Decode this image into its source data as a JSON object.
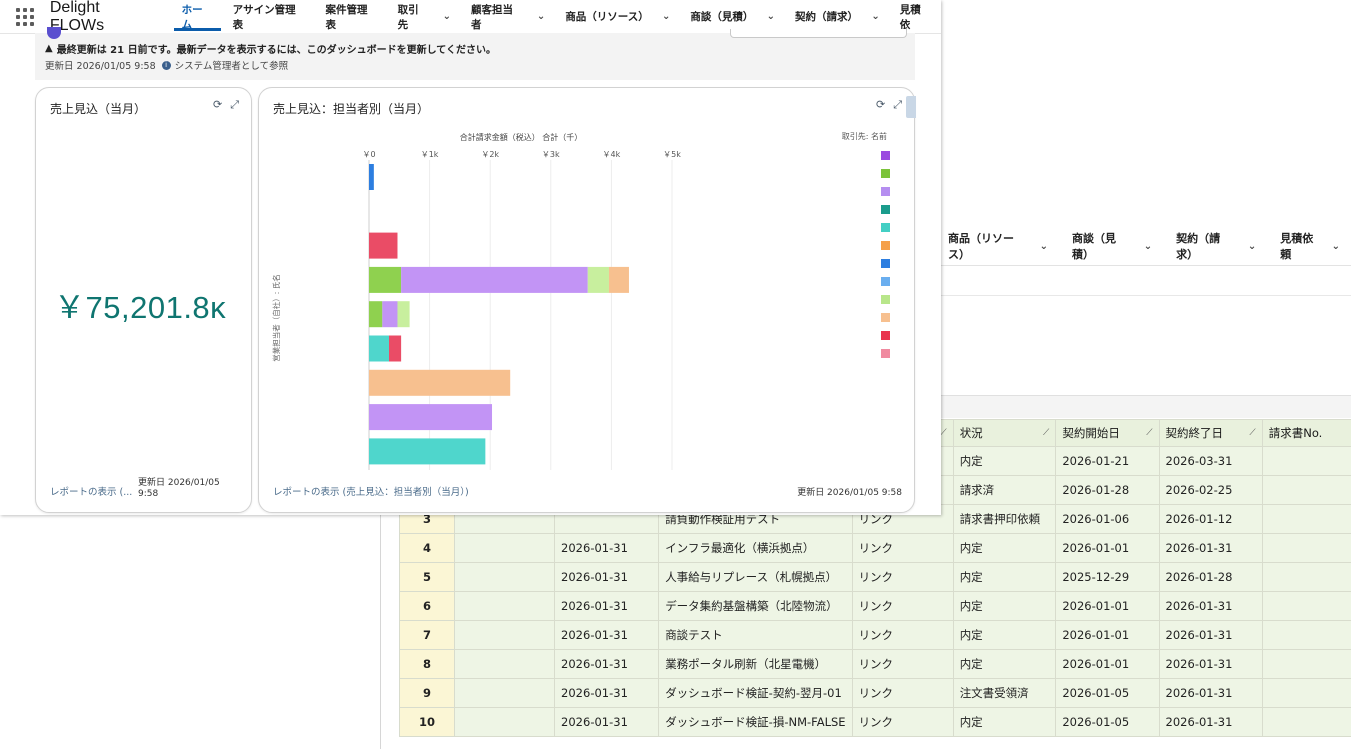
{
  "app": {
    "name": "Delight FLOWs",
    "nav": [
      {
        "label": "ホーム",
        "active": true,
        "chevron": false
      },
      {
        "label": "アサイン管理表",
        "active": false,
        "chevron": false
      },
      {
        "label": "案件管理表",
        "active": false,
        "chevron": false
      },
      {
        "label": "取引先",
        "active": false,
        "chevron": true
      },
      {
        "label": "顧客担当者",
        "active": false,
        "chevron": true
      },
      {
        "label": "商品（リソース）",
        "active": false,
        "chevron": true
      },
      {
        "label": "商談（見積）",
        "active": false,
        "chevron": true
      },
      {
        "label": "契約（請求）",
        "active": false,
        "chevron": true
      },
      {
        "label": "見積依",
        "active": false,
        "chevron": false
      }
    ]
  },
  "dashboard": {
    "warning": "最終更新は 21 日前です。最新データを表示するには、このダッシュボードを更新してください。",
    "updated_at": "更新日 2026/01/05 9:58",
    "viewing_as": "システム管理者として参照",
    "left_card": {
      "title": "売上見込（当月）",
      "metric": "￥75,201.8ĸ",
      "footer_link": "レポートの表示 (...",
      "footer_date": "更新日 2026/01/05 9:58"
    },
    "right_card": {
      "title": "売上見込：担当者別（当月）",
      "footer_link": "レポートの表示 (売上見込：担当者別（当月）)",
      "footer_date": "更新日 2026/01/05 9:58"
    }
  },
  "chart_data": {
    "type": "bar",
    "orientation": "horizontal",
    "stacked": true,
    "title": "合計請求金額（税込） 合計（千）",
    "xlabel": "",
    "ylabel": "営業担当者（自社）: 氏名",
    "xlim": [
      0,
      5000
    ],
    "x_ticks": [
      "￥0",
      "￥1k",
      "￥2k",
      "￥3k",
      "￥4k",
      "￥5k"
    ],
    "legend_title": "取引先: 名前",
    "legend_colors": [
      "#9b4be0",
      "#7cc33a",
      "#b58ef0",
      "#1a9c8c",
      "#43cfc4",
      "#f5a04a",
      "#2d7ee0",
      "#6aaeef",
      "#b8e68a",
      "#f7c08f",
      "#e9344f",
      "#f08aa0"
    ],
    "rows": [
      {
        "segments": [
          {
            "value": 80,
            "color": "#2d7ee0"
          }
        ]
      },
      {
        "segments": []
      },
      {
        "segments": [
          {
            "value": 470,
            "color": "#ea4c66"
          }
        ]
      },
      {
        "segments": [
          {
            "value": 530,
            "color": "#8fd14f"
          },
          {
            "value": 3080,
            "color": "#c294f5"
          },
          {
            "value": 350,
            "color": "#c8ef9e"
          },
          {
            "value": 330,
            "color": "#f7c08f"
          }
        ]
      },
      {
        "segments": [
          {
            "value": 220,
            "color": "#8fd14f"
          },
          {
            "value": 250,
            "color": "#c294f5"
          },
          {
            "value": 200,
            "color": "#c8ef9e"
          }
        ]
      },
      {
        "segments": [
          {
            "value": 330,
            "color": "#4fd6cc"
          },
          {
            "value": 200,
            "color": "#ea4c66"
          }
        ]
      },
      {
        "segments": [
          {
            "value": 2330,
            "color": "#f7c08f"
          }
        ]
      },
      {
        "segments": [
          {
            "value": 2030,
            "color": "#c294f5"
          }
        ]
      },
      {
        "segments": [
          {
            "value": 1920,
            "color": "#4fd6cc"
          }
        ]
      }
    ]
  },
  "back_window": {
    "nav": [
      {
        "label": "商品（リソース）"
      },
      {
        "label": "商談（見積）"
      },
      {
        "label": "契約（請求）"
      },
      {
        "label": "見積依頼"
      }
    ],
    "table": {
      "columns": [
        "",
        "",
        "",
        "",
        "",
        "状況",
        "契約開始日",
        "契約終了日",
        "請求書No."
      ],
      "rows": [
        {
          "no": "",
          "c2": "",
          "date": "",
          "name": "",
          "link": "",
          "status": "内定",
          "start": "2026-01-21",
          "end": "2026-03-31",
          "invoice": ""
        },
        {
          "no": "",
          "c2": "",
          "date": "",
          "name": "",
          "link": "",
          "status": "請求済",
          "start": "2026-01-28",
          "end": "2026-02-25",
          "invoice": ""
        },
        {
          "no": "3",
          "c2": "",
          "date": "",
          "name": "請負動作検証用テスト",
          "link": "リンク",
          "status": "請求書押印依頼",
          "start": "2026-01-06",
          "end": "2026-01-12",
          "invoice": ""
        },
        {
          "no": "4",
          "c2": "",
          "date": "2026-01-31",
          "name": "インフラ最適化（横浜拠点）",
          "link": "リンク",
          "status": "内定",
          "start": "2026-01-01",
          "end": "2026-01-31",
          "invoice": ""
        },
        {
          "no": "5",
          "c2": "",
          "date": "2026-01-31",
          "name": "人事給与リプレース（札幌拠点）",
          "link": "リンク",
          "status": "内定",
          "start": "2025-12-29",
          "end": "2026-01-28",
          "invoice": ""
        },
        {
          "no": "6",
          "c2": "",
          "date": "2026-01-31",
          "name": "データ集約基盤構築（北陸物流）",
          "link": "リンク",
          "status": "内定",
          "start": "2026-01-01",
          "end": "2026-01-31",
          "invoice": ""
        },
        {
          "no": "7",
          "c2": "",
          "date": "2026-01-31",
          "name": "商談テスト",
          "link": "リンク",
          "status": "内定",
          "start": "2026-01-01",
          "end": "2026-01-31",
          "invoice": ""
        },
        {
          "no": "8",
          "c2": "",
          "date": "2026-01-31",
          "name": "業務ポータル刷新（北星電機）",
          "link": "リンク",
          "status": "内定",
          "start": "2026-01-01",
          "end": "2026-01-31",
          "invoice": ""
        },
        {
          "no": "9",
          "c2": "",
          "date": "2026-01-31",
          "name": "ダッシュボード検証-契約-翌月-01",
          "link": "リンク",
          "status": "注文書受領済",
          "start": "2026-01-05",
          "end": "2026-01-31",
          "invoice": ""
        },
        {
          "no": "10",
          "c2": "",
          "date": "2026-01-31",
          "name": "ダッシュボード検証-損-NM-FALSE",
          "link": "リンク",
          "status": "内定",
          "start": "2026-01-05",
          "end": "2026-01-31",
          "invoice": ""
        }
      ]
    }
  }
}
